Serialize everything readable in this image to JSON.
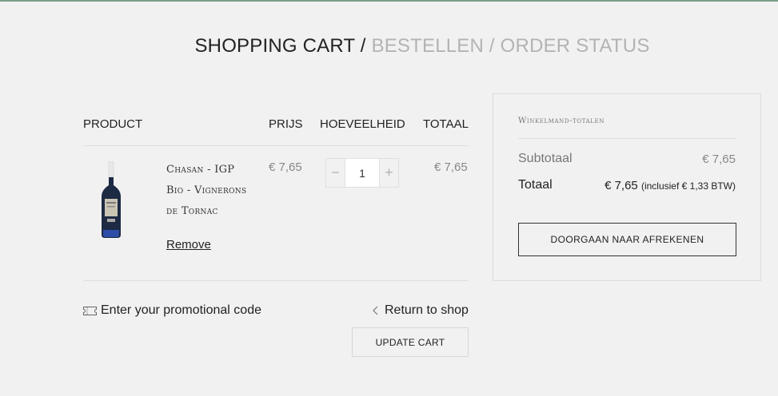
{
  "steps": {
    "step1": "SHOPPING CART",
    "sep1": "/",
    "step2": "BESTELLEN",
    "sep2": "/",
    "step3": "ORDER STATUS"
  },
  "table": {
    "col_product": "PRODUCT",
    "col_price": "PRIJS",
    "col_qty": "HOEVEELHEID",
    "col_total": "TOTAAL"
  },
  "item": {
    "name": "Chasan - IGP Bio - Vignerons de Tornac",
    "price": "€ 7,65",
    "quantity": "1",
    "total": "€ 7,65",
    "remove_label": "Remove",
    "minus": "−",
    "plus": "+"
  },
  "promo_label": "Enter your promotional code",
  "return_label": "Return to shop",
  "update_label": "UPDATE CART",
  "totals": {
    "title": "Winkelmand-totalen",
    "subtotal_label": "Subtotaal",
    "subtotal_value": "€ 7,65",
    "total_label": "Totaal",
    "total_value": "€ 7,65",
    "tax_note": "(inclusief € 1,33 BTW)",
    "checkout_label": "DOORGAAN NAAR AFREKENEN"
  },
  "colors": {
    "accent_bar": "#7b9e8a",
    "inactive_step": "#b3b3b3",
    "muted_price": "#888888"
  }
}
